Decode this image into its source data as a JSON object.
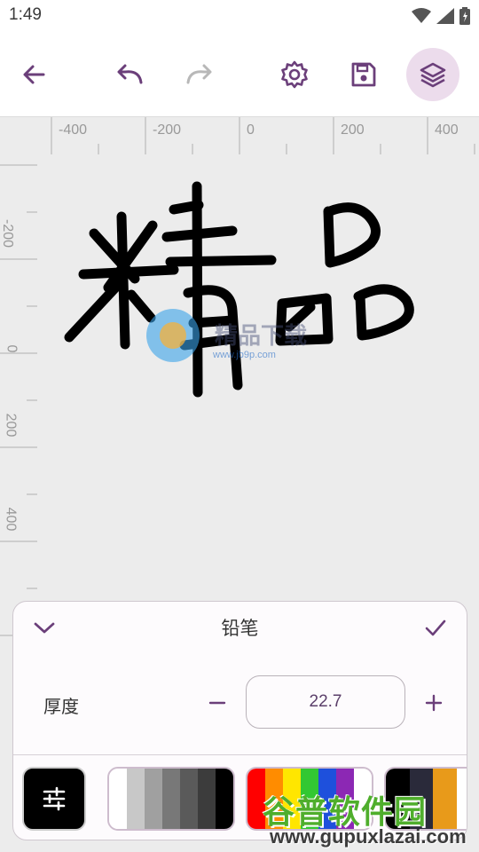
{
  "status_bar": {
    "time": "1:49",
    "icons": [
      "wifi-icon",
      "signal-icon",
      "battery-icon"
    ]
  },
  "toolbar": {
    "buttons": [
      "back-arrow-icon",
      "undo-icon",
      "redo-icon",
      "settings-icon",
      "save-icon",
      "layers-icon"
    ],
    "accent_color": "#6b3f7a",
    "disabled_color": "#b8b8b8",
    "active_bg": "#ecdcec"
  },
  "ruler": {
    "top_labels": [
      "-400",
      "-200",
      "0",
      "200",
      "400"
    ],
    "left_labels": [
      "-200",
      "0",
      "200",
      "400"
    ]
  },
  "canvas": {
    "background": "#ececec",
    "stroke_color": "#000000",
    "watermark_text": "精品下载",
    "watermark_url": "www.jb9p.com"
  },
  "tool_panel": {
    "title": "铅笔",
    "thickness_label": "厚度",
    "thickness_value": "22.7",
    "minus": "−",
    "plus": "+",
    "palettes": [
      {
        "name": "grays",
        "colors": [
          "#ffffff",
          "#c8c8c8",
          "#a0a0a0",
          "#787878",
          "#5a5a5a",
          "#3c3c3c",
          "#000000"
        ]
      },
      {
        "name": "brights",
        "colors": [
          "#ff0000",
          "#ff8c00",
          "#ffe600",
          "#32c832",
          "#1e50dc",
          "#8c28b4",
          "#ffffff"
        ]
      },
      {
        "name": "darks",
        "colors": [
          "#000000",
          "#2a2a3a",
          "#e89a1a",
          "#ffffff"
        ]
      }
    ]
  },
  "watermark": {
    "title": "谷普软件园",
    "url": "www.gupuxlazai.com"
  }
}
